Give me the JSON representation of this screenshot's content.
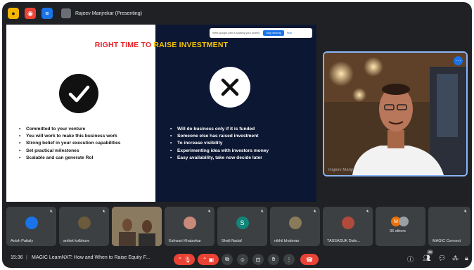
{
  "presenter": {
    "label": "Rajeev Manjrekar (Presenting)"
  },
  "share_banner": {
    "text": "meet.google.com is sharing your screen.",
    "stop_label": "Stop sharing",
    "hide_label": "Hide"
  },
  "slide": {
    "title_part1": "RIGHT TIME TO",
    "title_part2": " RAISE INVESTMENT",
    "left_bullets": [
      "Committed to your venture",
      "You will work to make this business work",
      "Strong belief in your execution capabilities",
      "Set practical milestones",
      "Scalable and can generate RoI"
    ],
    "right_bullets": [
      "Will do business only if it is funded",
      "Someone else has raised investment",
      "To increase visibility",
      "Experimenting idea with investors money",
      "Easy availability, take now decide later"
    ]
  },
  "video": {
    "name": "Rajeev Manjrekar"
  },
  "participants": [
    {
      "name": "Anish Pattaly",
      "avatar_letter": "",
      "avatar_color": "#1a73e8"
    },
    {
      "name": "aniket kolbhure",
      "avatar_letter": "",
      "avatar_color": "#6b5a3c"
    },
    {
      "name": "",
      "avatar_letter": "",
      "avatar_color": "#7b6a52"
    },
    {
      "name": "Eshwari Khatavkar",
      "avatar_letter": "",
      "avatar_color": "#c98a7a"
    },
    {
      "name": "Shafi Nadaf",
      "avatar_letter": "S",
      "avatar_color": "#12857a"
    },
    {
      "name": "nikhil bhalerao",
      "avatar_letter": "",
      "avatar_color": "#8a7a5a"
    },
    {
      "name": "TASSADUK Dafe...",
      "avatar_letter": "",
      "avatar_color": "#b04a3a"
    },
    {
      "name": "36 others",
      "avatar_letter": "M",
      "avatar_color": "#e8710a"
    },
    {
      "name": "MAGIC Connect",
      "avatar_letter": "",
      "avatar_color": "#3c4043"
    }
  ],
  "bottombar": {
    "time": "15:36",
    "separator": "|",
    "meeting_title": "MAGIC LearnNXT: How and When to Raise Equity F...",
    "participant_count": "45"
  },
  "colors": {
    "accent": "#8ab4f8",
    "danger": "#ea4335",
    "slide_bg": "#0c1733"
  }
}
